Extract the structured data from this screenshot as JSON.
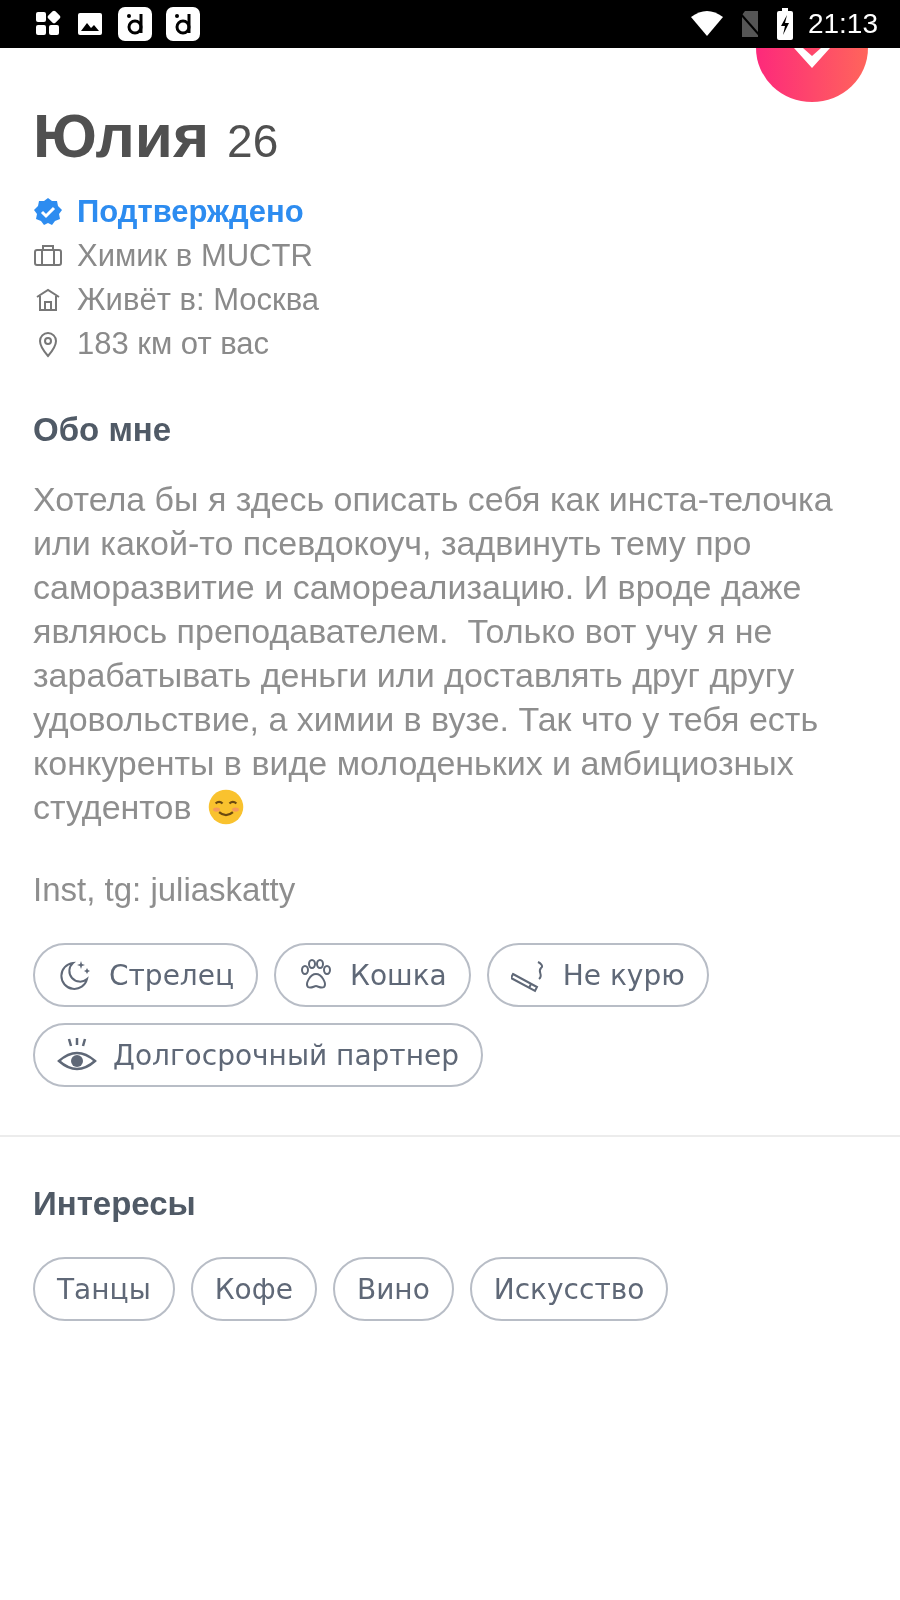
{
  "status_bar": {
    "time": "21:13"
  },
  "profile": {
    "name": "Юлия",
    "age": "26",
    "details": [
      {
        "kind": "verified",
        "text": "Подтверждено"
      },
      {
        "kind": "job",
        "text": "Химик в MUCTR"
      },
      {
        "kind": "home",
        "text": "Живёт в: Москва"
      },
      {
        "kind": "distance",
        "text": "183 км от вас"
      }
    ]
  },
  "about": {
    "heading": "Обо мне",
    "text": "Хотела бы я здесь описать себя как инста-телочка или какой-то псевдокоуч, задвинуть тему про саморазвитие и самореализацию. И вроде даже являюсь преподавателем.  Только вот учу я не зарабатывать деньги или доставлять друг другу удовольствие, а химии в вузе. Так что у тебя есть конкуренты в виде молоденьких и амбициозных",
    "text_last_line": "студентов",
    "contact": "Inst, tg: juliaskatty"
  },
  "basics": [
    {
      "kind": "zodiac",
      "label": "Стрелец"
    },
    {
      "kind": "pet",
      "label": "Кошка"
    },
    {
      "kind": "smoking",
      "label": "Не курю"
    },
    {
      "kind": "looking_for",
      "label": "Долгосрочный партнер"
    }
  ],
  "interests": {
    "heading": "Интересы",
    "items": [
      "Танцы",
      "Кофе",
      "Вино",
      "Искусство"
    ]
  }
}
